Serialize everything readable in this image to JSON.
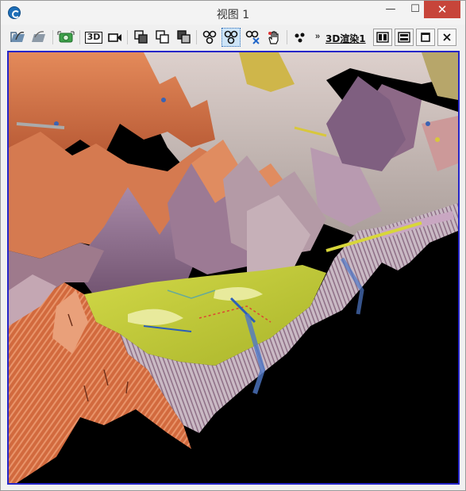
{
  "window": {
    "title": "视图 1",
    "minimize_glyph": "—",
    "maximize_glyph": "☐",
    "close_glyph": "✕"
  },
  "toolbar": {
    "overflow_glyph": "»",
    "render_tab_label": "3D渲染1",
    "badge_3d": "3D",
    "icons": [
      "open-icon",
      "save-icon",
      "snapshot-icon",
      "3d-view-icon",
      "camera-icon",
      "layer-stack-icon",
      "layer-copy-icon",
      "layer-merge-icon",
      "network-icon",
      "network-selected-icon",
      "network-remove-icon",
      "pan-hand-icon",
      "points-icon",
      "split-vertical-icon",
      "split-horizontal-icon",
      "restore-icon",
      "close-view-icon"
    ]
  },
  "colors": {
    "viewport_border": "#2525c8",
    "viewport_background": "#000000",
    "terrain_orange": "#d9774a",
    "terrain_purple": "#8f6a8a",
    "terrain_yellow": "#c9cf3a",
    "terrain_gray": "#c8b8b4",
    "close_button": "#c7453a"
  }
}
